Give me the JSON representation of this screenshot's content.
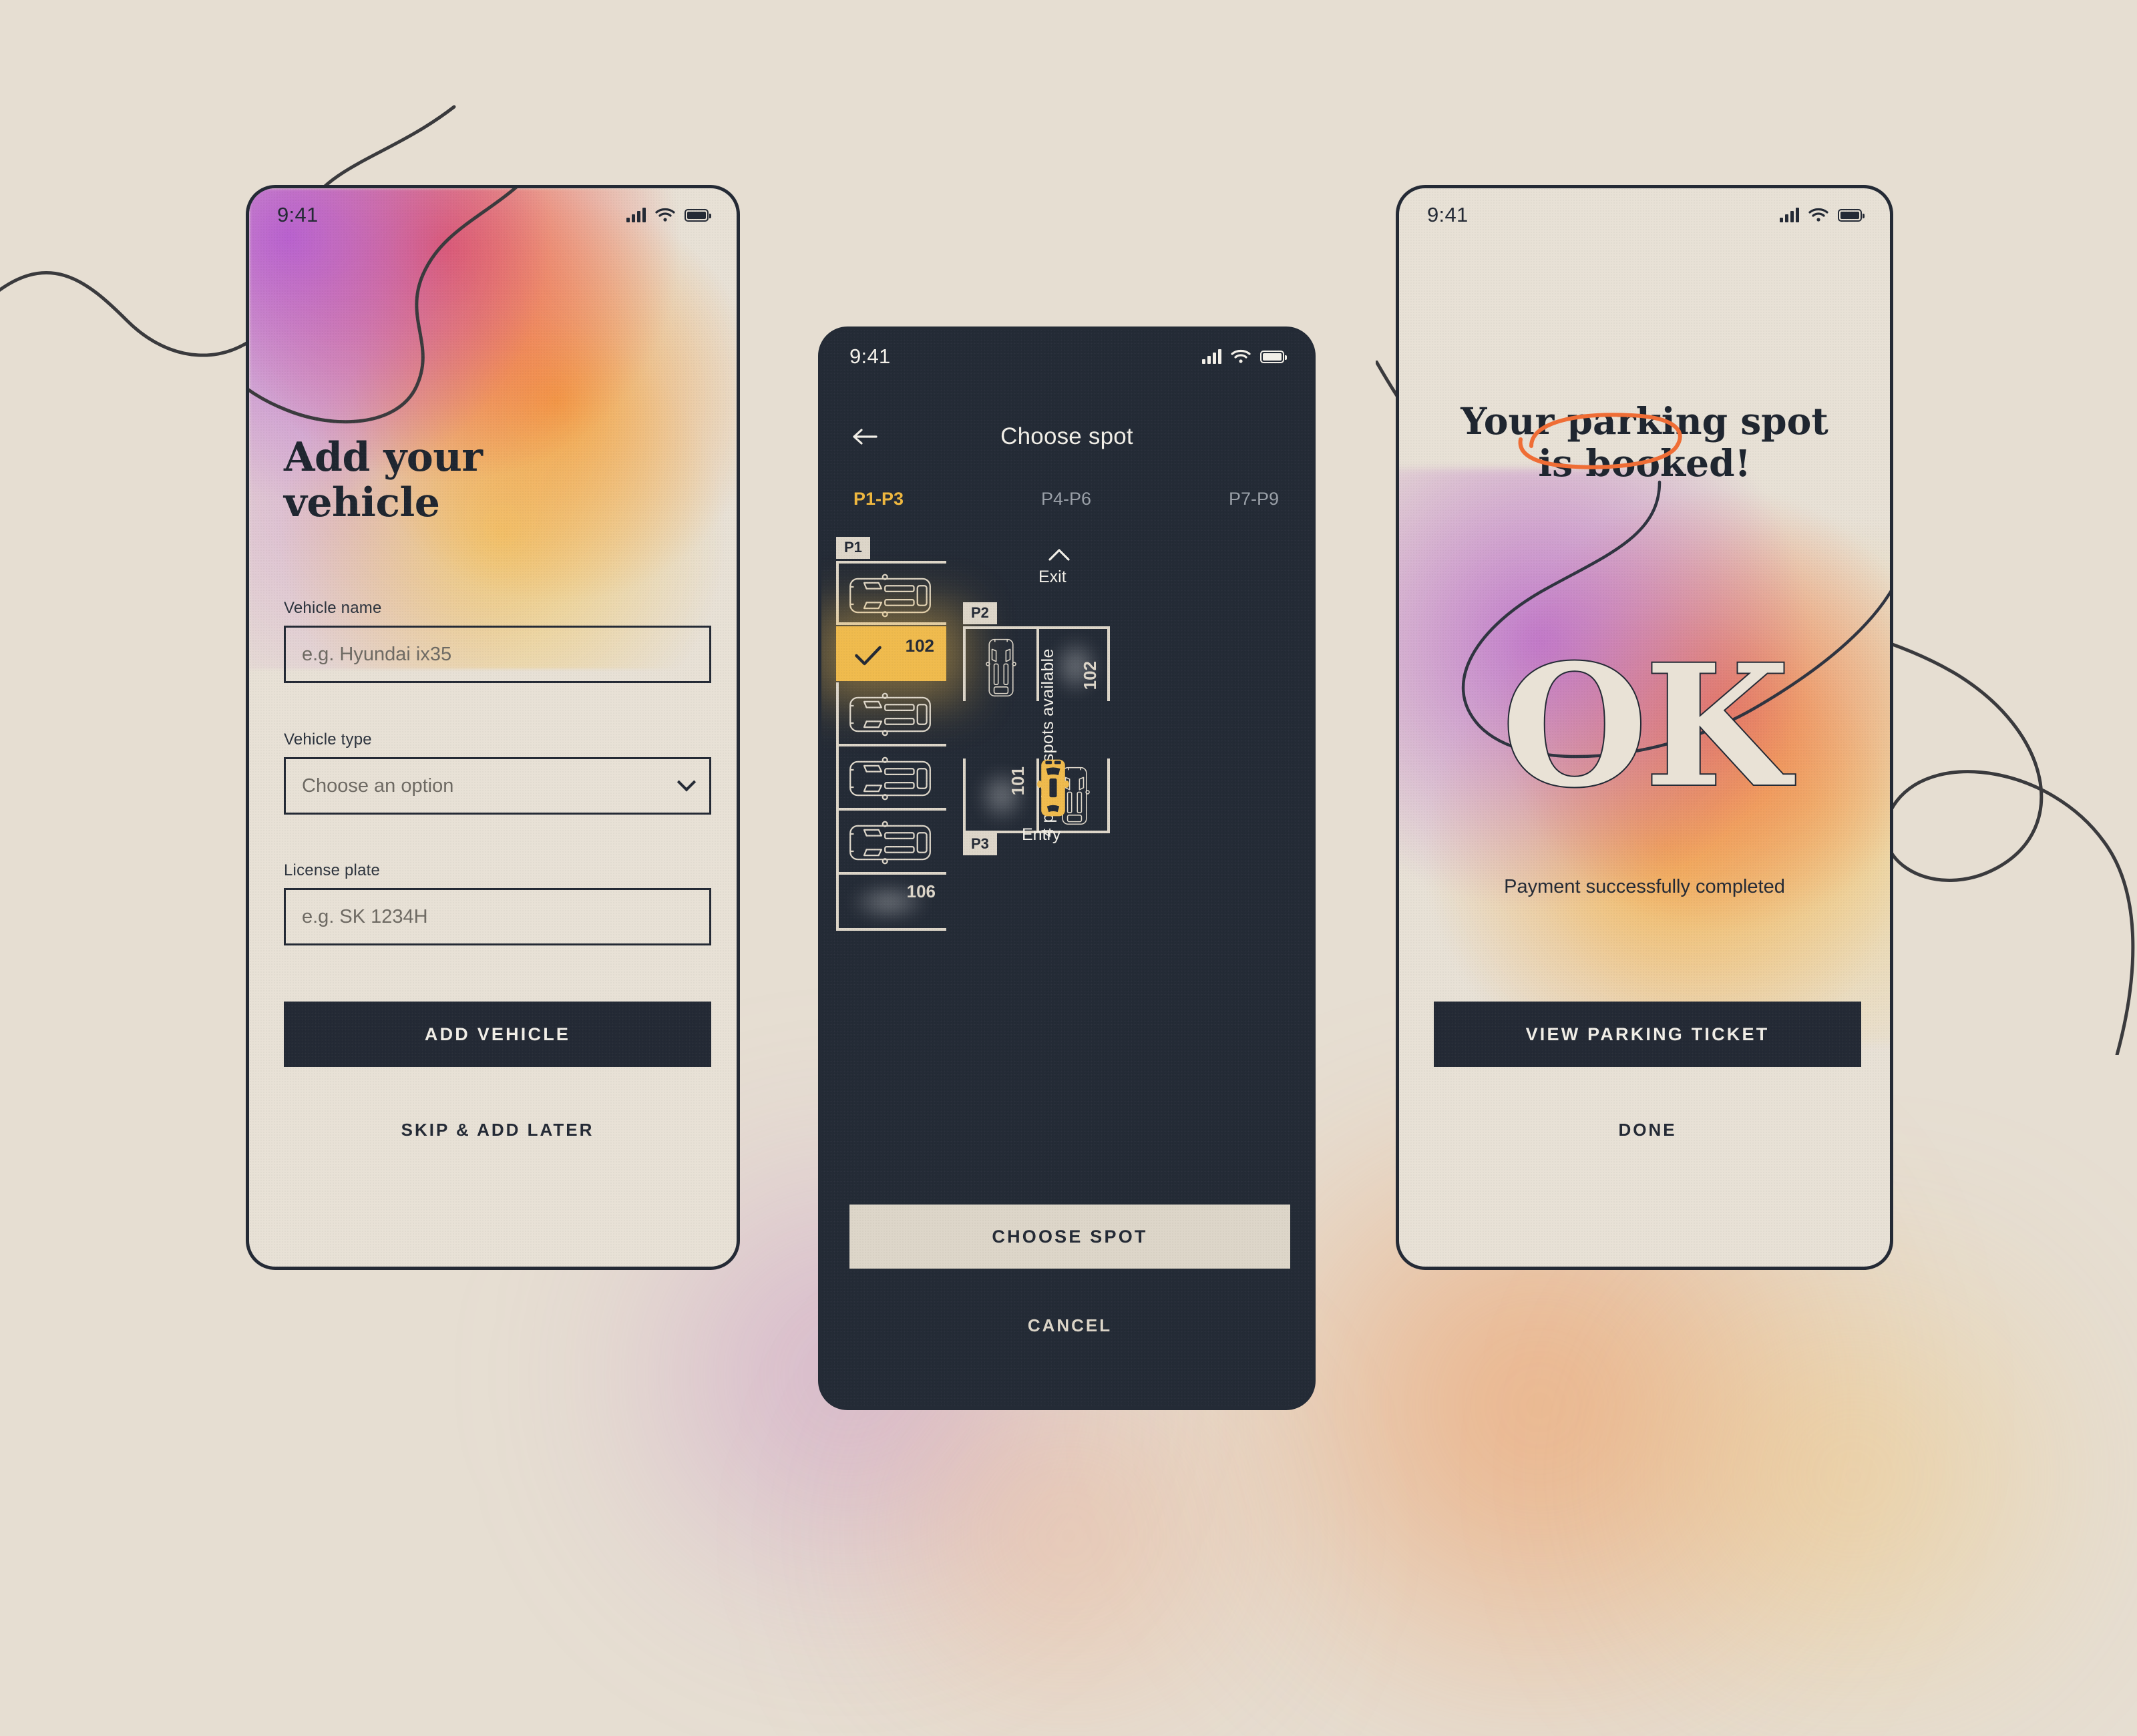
{
  "colors": {
    "page_bg": "#e6ded2",
    "ink": "#242a35",
    "paper": "#e8e1d6",
    "accent_yellow": "#f0bb4d",
    "accent_orange": "#ef6d35",
    "tab_active": "#f0b83f"
  },
  "phone_add_vehicle": {
    "status": {
      "time": "9:41",
      "cellular_icon": "cellular-bars-icon",
      "wifi_icon": "wifi-icon",
      "battery_icon": "battery-full-icon"
    },
    "title_line1": "Add your",
    "title_line2": "vehicle",
    "fields": [
      {
        "label": "Vehicle name",
        "placeholder": "e.g. Hyundai ix35",
        "value": "",
        "type": "text"
      },
      {
        "label": "Vehicle type",
        "placeholder": "Choose an option",
        "value": "",
        "type": "select"
      },
      {
        "label": "License plate",
        "placeholder": "e.g. SK 1234H",
        "value": "",
        "type": "text"
      }
    ],
    "primary_button": "ADD VEHICLE",
    "secondary_button": "SKIP & ADD LATER"
  },
  "phone_choose_spot": {
    "status": {
      "time": "9:41",
      "cellular_icon": "cellular-bars-icon",
      "wifi_icon": "wifi-icon",
      "battery_icon": "battery-full-icon"
    },
    "back_icon": "back-arrow-icon",
    "title": "Choose spot",
    "tabs": [
      {
        "label": "P1-P3",
        "active": true
      },
      {
        "label": "P4-P6",
        "active": false
      },
      {
        "label": "P7-P9",
        "active": false
      }
    ],
    "map": {
      "exit_label": "Exit",
      "exit_icon": "chevron-up-icon",
      "entry_label": "Entry",
      "entry_vehicle_icon": "car-top-view-icon",
      "availability_note": "4 parking spots available",
      "lots": [
        {
          "tag": "P1",
          "slots": [
            {
              "state": "occupied",
              "number": ""
            },
            {
              "state": "selected",
              "number": "102",
              "check_icon": "check-icon"
            },
            {
              "state": "occupied",
              "number": ""
            },
            {
              "state": "occupied",
              "number": ""
            },
            {
              "state": "occupied",
              "number": ""
            },
            {
              "state": "free",
              "number": "106"
            }
          ]
        },
        {
          "tag": "P2",
          "slots": [
            {
              "state": "occupied",
              "number": ""
            },
            {
              "state": "free",
              "number": "102"
            }
          ]
        },
        {
          "tag": "P3",
          "slots": [
            {
              "state": "free",
              "number": "101"
            },
            {
              "state": "occupied",
              "number": ""
            }
          ]
        }
      ]
    },
    "primary_button": "CHOOSE SPOT",
    "secondary_button": "CANCEL"
  },
  "phone_booked": {
    "status": {
      "time": "9:41",
      "cellular_icon": "cellular-bars-icon",
      "wifi_icon": "wifi-icon",
      "battery_icon": "battery-full-icon"
    },
    "headline_line1": "Your parking spot",
    "headline_line2_pre": "is ",
    "headline_line2_highlight": "booked!",
    "hero_text": "OK",
    "subtitle": "Payment successfully completed",
    "primary_button": "VIEW PARKING TICKET",
    "secondary_button": "DONE"
  }
}
